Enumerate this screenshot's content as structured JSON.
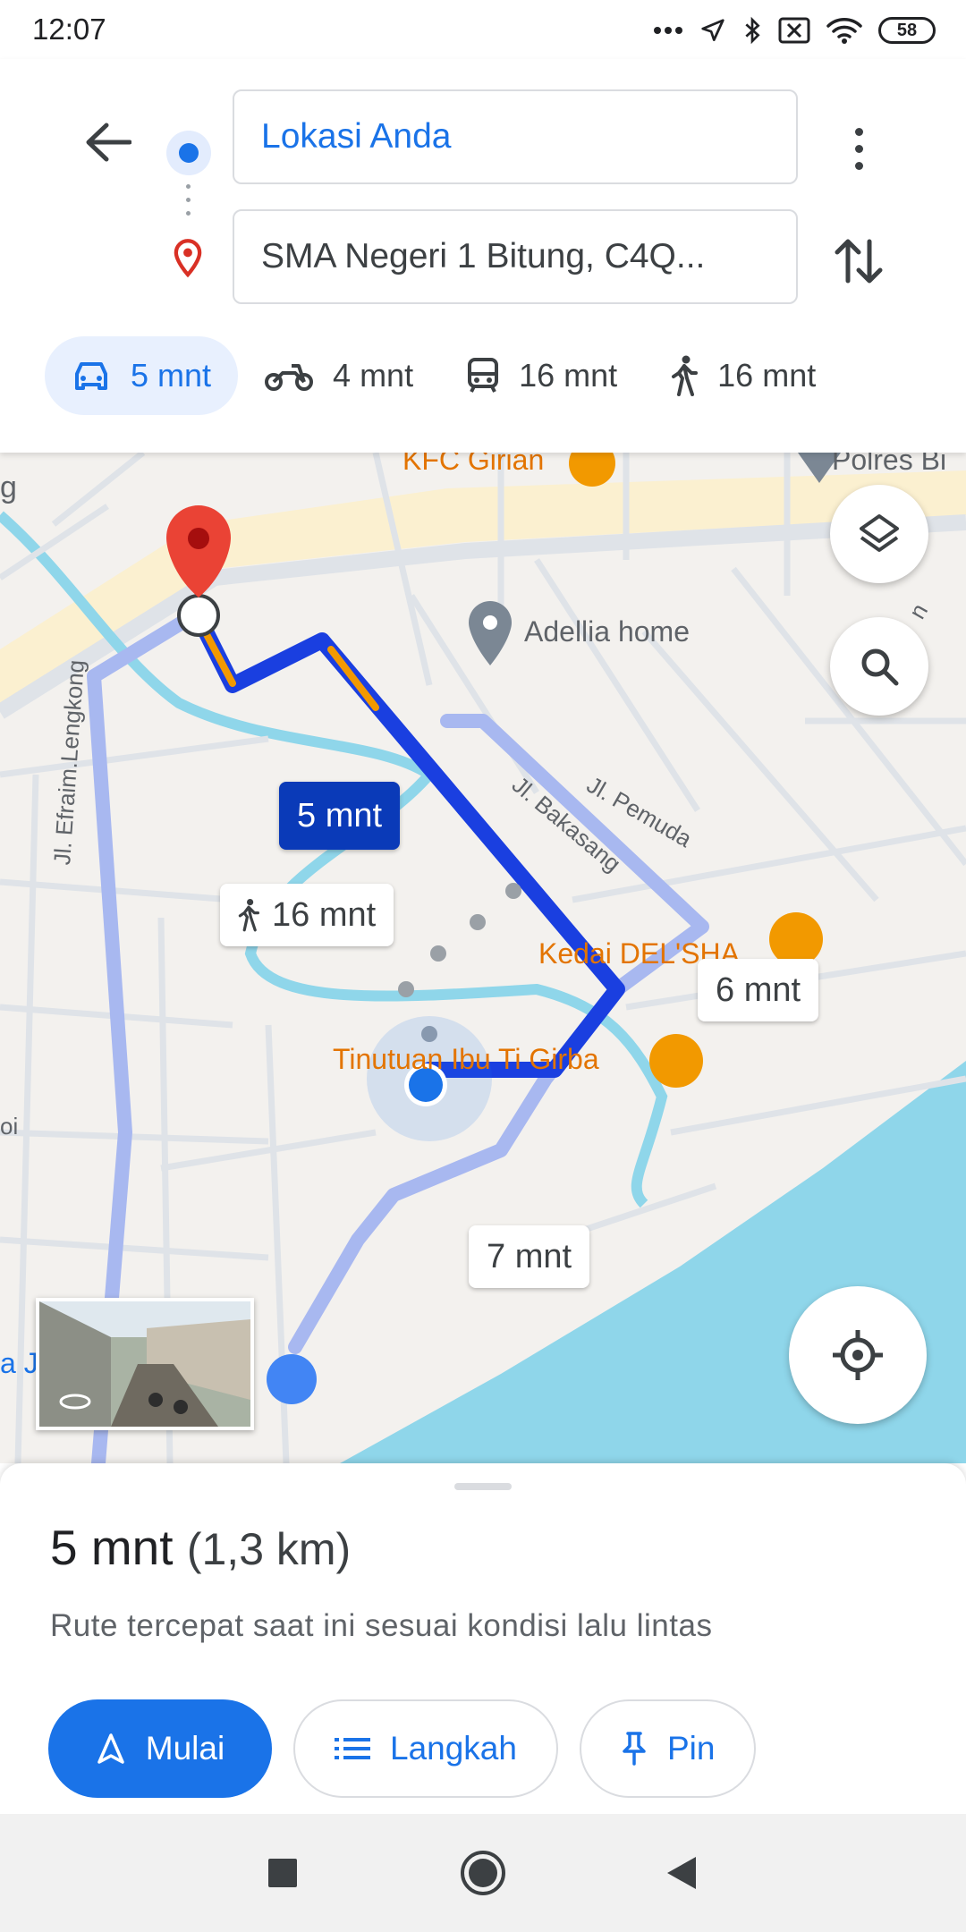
{
  "status_bar": {
    "time": "12:07",
    "battery": "58"
  },
  "directions": {
    "origin": "Lokasi Anda",
    "destination": "SMA Negeri 1 Bitung, C4Q..."
  },
  "modes": [
    {
      "id": "car",
      "label": "5 mnt",
      "active": true
    },
    {
      "id": "motorcycle",
      "label": "4 mnt",
      "active": false
    },
    {
      "id": "transit",
      "label": "16 mnt",
      "active": false
    },
    {
      "id": "walk",
      "label": "16 mnt",
      "active": false
    }
  ],
  "map": {
    "pois": {
      "kfc": "KFC Girian",
      "polres": "Polres Bi",
      "adellia": "Adellia home",
      "kedai": "Kedai DEL'SHA",
      "tinutuan": "Tinutuan Ibu Ti Girba"
    },
    "streets": {
      "efraim": "Jl. Efraim.Lengkong",
      "bakasang": "Jl. Bakasang",
      "pemuda": "Jl. Pemuda",
      "edge_left": "g",
      "edge_bottom_left": "a J",
      "edge_right": "n",
      "edge_left_mid": "oi"
    },
    "bubbles": {
      "primary": "5 mnt",
      "walk": "16 mnt",
      "alt1": "6 mnt",
      "alt2": "7 mnt"
    },
    "colors": {
      "route_primary": "#1a3fe0",
      "route_alt": "#a8b8f0",
      "traffic": "#f29900",
      "water": "#8fd6ea"
    }
  },
  "sheet": {
    "duration": "5 mnt",
    "distance": "(1,3 km)",
    "subtitle": "Rute tercepat saat ini sesuai kondisi lalu lintas",
    "buttons": {
      "start": "Mulai",
      "steps": "Langkah",
      "pin": "Pin"
    }
  }
}
